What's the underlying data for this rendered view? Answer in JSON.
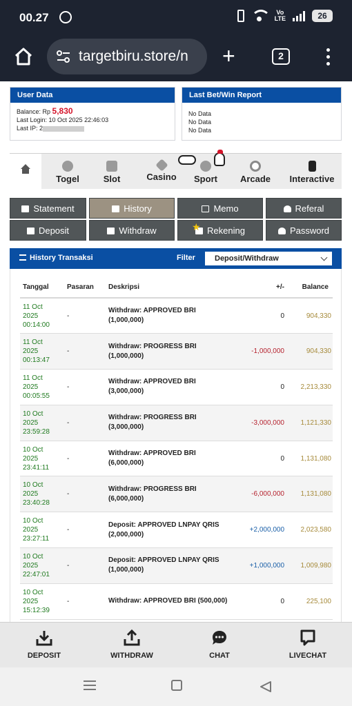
{
  "status_bar": {
    "time": "00.27",
    "battery": "26",
    "network": "LTE"
  },
  "browser": {
    "url": "targetbiru.store/n",
    "tab_count": "2"
  },
  "user_data": {
    "title": "User Data",
    "balance_label": "Balance: Rp",
    "balance_value": "5,830",
    "last_login": "Last Login: 10 Oct 2025 22:46:03",
    "last_ip_label": "Last IP: 2"
  },
  "last_bet": {
    "title": "Last Bet/Win Report",
    "lines": [
      "No Data",
      "No Data",
      "No Data"
    ]
  },
  "game_tabs": [
    {
      "label": "",
      "icon": "home-icon"
    },
    {
      "label": "Togel",
      "icon": "togel-icon"
    },
    {
      "label": "Slot",
      "icon": "slot-icon"
    },
    {
      "label": "Casino",
      "icon": "casino-icon"
    },
    {
      "label": "Sport",
      "icon": "sport-icon"
    },
    {
      "label": "Arcade",
      "icon": "arcade-icon"
    },
    {
      "label": "Interactive",
      "icon": "interactive-icon"
    }
  ],
  "menu_buttons": [
    {
      "label": "Statement",
      "icon": "calendar-icon"
    },
    {
      "label": "History",
      "icon": "calendar-icon"
    },
    {
      "label": "Memo",
      "icon": "edit-icon"
    },
    {
      "label": "Referal",
      "icon": "user-icon"
    },
    {
      "label": "Deposit",
      "icon": "download-icon"
    },
    {
      "label": "Withdraw",
      "icon": "upload-icon"
    },
    {
      "label": "Rekening",
      "icon": "bank-icon"
    },
    {
      "label": "Password",
      "icon": "user-icon"
    }
  ],
  "history": {
    "title": "History Transaksi",
    "filter_label": "Filter",
    "filter_value": "Deposit/Withdraw",
    "columns": [
      "Tanggal",
      "Pasaran",
      "Deskripsi",
      "+/-",
      "Balance"
    ],
    "rows": [
      {
        "date": [
          "11 Oct",
          "2025",
          "00:14:00"
        ],
        "pasaran": "-",
        "desc": [
          "Withdraw: APPROVED BRI",
          "(1,000,000)"
        ],
        "amount": "0",
        "balance": "904,330",
        "sign": "zero"
      },
      {
        "date": [
          "11 Oct",
          "2025",
          "00:13:47"
        ],
        "pasaran": "-",
        "desc": [
          "Withdraw: PROGRESS BRI",
          "(1,000,000)"
        ],
        "amount": "-1,000,000",
        "balance": "904,330",
        "sign": "neg"
      },
      {
        "date": [
          "11 Oct",
          "2025",
          "00:05:55"
        ],
        "pasaran": "-",
        "desc": [
          "Withdraw: APPROVED BRI",
          "(3,000,000)"
        ],
        "amount": "0",
        "balance": "2,213,330",
        "sign": "zero"
      },
      {
        "date": [
          "10 Oct",
          "2025",
          "23:59:28"
        ],
        "pasaran": "-",
        "desc": [
          "Withdraw: PROGRESS BRI",
          "(3,000,000)"
        ],
        "amount": "-3,000,000",
        "balance": "1,121,330",
        "sign": "neg"
      },
      {
        "date": [
          "10 Oct",
          "2025",
          "23:41:11"
        ],
        "pasaran": "-",
        "desc": [
          "Withdraw: APPROVED BRI",
          "(6,000,000)"
        ],
        "amount": "0",
        "balance": "1,131,080",
        "sign": "zero"
      },
      {
        "date": [
          "10 Oct",
          "2025",
          "23:40:28"
        ],
        "pasaran": "-",
        "desc": [
          "Withdraw: PROGRESS BRI",
          "(6,000,000)"
        ],
        "amount": "-6,000,000",
        "balance": "1,131,080",
        "sign": "neg"
      },
      {
        "date": [
          "10 Oct",
          "2025",
          "23:27:11"
        ],
        "pasaran": "-",
        "desc": [
          "Deposit: APPROVED LNPAY QRIS",
          "(2,000,000)"
        ],
        "amount": "+2,000,000",
        "balance": "2,023,580",
        "sign": "pos"
      },
      {
        "date": [
          "10 Oct",
          "2025",
          "22:47:01"
        ],
        "pasaran": "-",
        "desc": [
          "Deposit: APPROVED LNPAY QRIS",
          "(1,000,000)"
        ],
        "amount": "+1,000,000",
        "balance": "1,009,980",
        "sign": "pos"
      },
      {
        "date": [
          "10 Oct",
          "2025",
          "15:12:39"
        ],
        "pasaran": "-",
        "desc": [
          "Withdraw: APPROVED BRI (500,000)",
          ""
        ],
        "amount": "0",
        "balance": "225,100",
        "sign": "zero"
      }
    ]
  },
  "bottom_bar": [
    {
      "label": "DEPOSIT",
      "icon": "deposit-icon"
    },
    {
      "label": "WITHDRAW",
      "icon": "withdraw-icon"
    },
    {
      "label": "CHAT",
      "icon": "chat-icon"
    },
    {
      "label": "LIVECHAT",
      "icon": "livechat-icon"
    }
  ],
  "colors": {
    "header_blue": "#0a4fa3",
    "balance_red": "#d4142a",
    "date_green": "#1f7a1f",
    "balance_gold": "#a68a3a"
  }
}
